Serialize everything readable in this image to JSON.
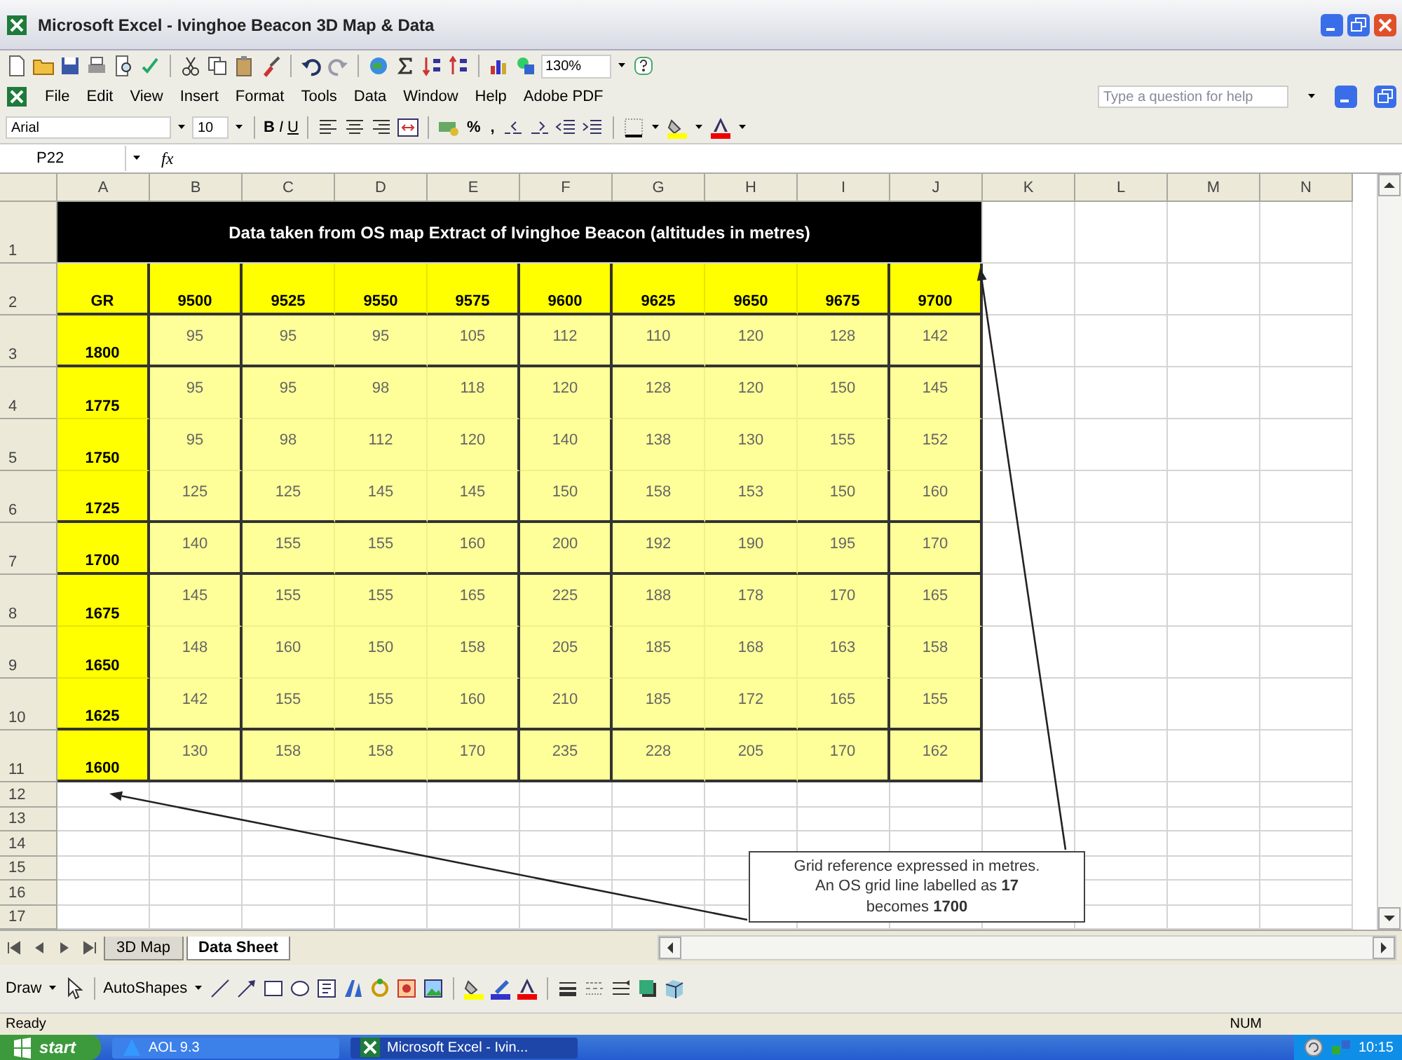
{
  "window": {
    "title": "Microsoft Excel - Ivinghoe Beacon 3D Map & Data"
  },
  "standard_toolbar": {
    "zoom": "130%"
  },
  "menu": [
    "File",
    "Edit",
    "View",
    "Insert",
    "Format",
    "Tools",
    "Data",
    "Window",
    "Help",
    "Adobe PDF"
  ],
  "help_search": {
    "placeholder": "Type a question for help"
  },
  "formatting_toolbar": {
    "font": "Arial",
    "size": "10",
    "buttons": [
      "B",
      "I",
      "U"
    ],
    "number_buttons": [
      "%",
      ","
    ]
  },
  "formula_bar": {
    "name_box": "P22",
    "function_label": "fx"
  },
  "columns": [
    "A",
    "B",
    "C",
    "D",
    "E",
    "F",
    "G",
    "H",
    "I",
    "J",
    "K",
    "L",
    "M",
    "N"
  ],
  "row_numbers": [
    "1",
    "2",
    "3",
    "4",
    "5",
    "6",
    "7",
    "8",
    "9",
    "10",
    "11",
    "12",
    "13",
    "14",
    "15",
    "16",
    "17"
  ],
  "sheet": {
    "title": "Data taken from OS map Extract of Ivinghoe Beacon (altitudes in metres)",
    "header": [
      "GR",
      "9500",
      "9525",
      "9550",
      "9575",
      "9600",
      "9625",
      "9650",
      "9675",
      "9700"
    ],
    "rows": [
      {
        "label": "1800",
        "values": [
          "95",
          "95",
          "95",
          "105",
          "112",
          "110",
          "120",
          "128",
          "142"
        ]
      },
      {
        "label": "1775",
        "values": [
          "95",
          "95",
          "98",
          "118",
          "120",
          "128",
          "120",
          "150",
          "145"
        ]
      },
      {
        "label": "1750",
        "values": [
          "95",
          "98",
          "112",
          "120",
          "140",
          "138",
          "130",
          "155",
          "152"
        ]
      },
      {
        "label": "1725",
        "values": [
          "125",
          "125",
          "145",
          "145",
          "150",
          "158",
          "153",
          "150",
          "160"
        ]
      },
      {
        "label": "1700",
        "values": [
          "140",
          "155",
          "155",
          "160",
          "200",
          "192",
          "190",
          "195",
          "170"
        ]
      },
      {
        "label": "1675",
        "values": [
          "145",
          "155",
          "155",
          "165",
          "225",
          "188",
          "178",
          "170",
          "165"
        ]
      },
      {
        "label": "1650",
        "values": [
          "148",
          "160",
          "150",
          "158",
          "205",
          "185",
          "168",
          "163",
          "158"
        ]
      },
      {
        "label": "1625",
        "values": [
          "142",
          "155",
          "155",
          "160",
          "210",
          "185",
          "172",
          "165",
          "155"
        ]
      },
      {
        "label": "1600",
        "values": [
          "130",
          "158",
          "158",
          "170",
          "235",
          "228",
          "205",
          "170",
          "162"
        ]
      }
    ]
  },
  "callout": {
    "text": "Grid reference expressed in metres. An OS grid line labelled as **17** becomes **1700**"
  },
  "sheet_tabs": [
    {
      "label": "3D Map",
      "selected": false
    },
    {
      "label": "Data Sheet",
      "selected": true
    }
  ],
  "drawing_toolbar": {
    "draw": "Draw",
    "autoshapes": "AutoShapes"
  },
  "status_bar": {
    "status": "Ready",
    "indicator": "NUM"
  },
  "taskbar": {
    "start": "start",
    "items": [
      {
        "label": "AOL 9.3",
        "selected": false
      },
      {
        "label": "Microsoft Excel - Ivin...",
        "selected": true
      }
    ],
    "time": "10:15"
  }
}
